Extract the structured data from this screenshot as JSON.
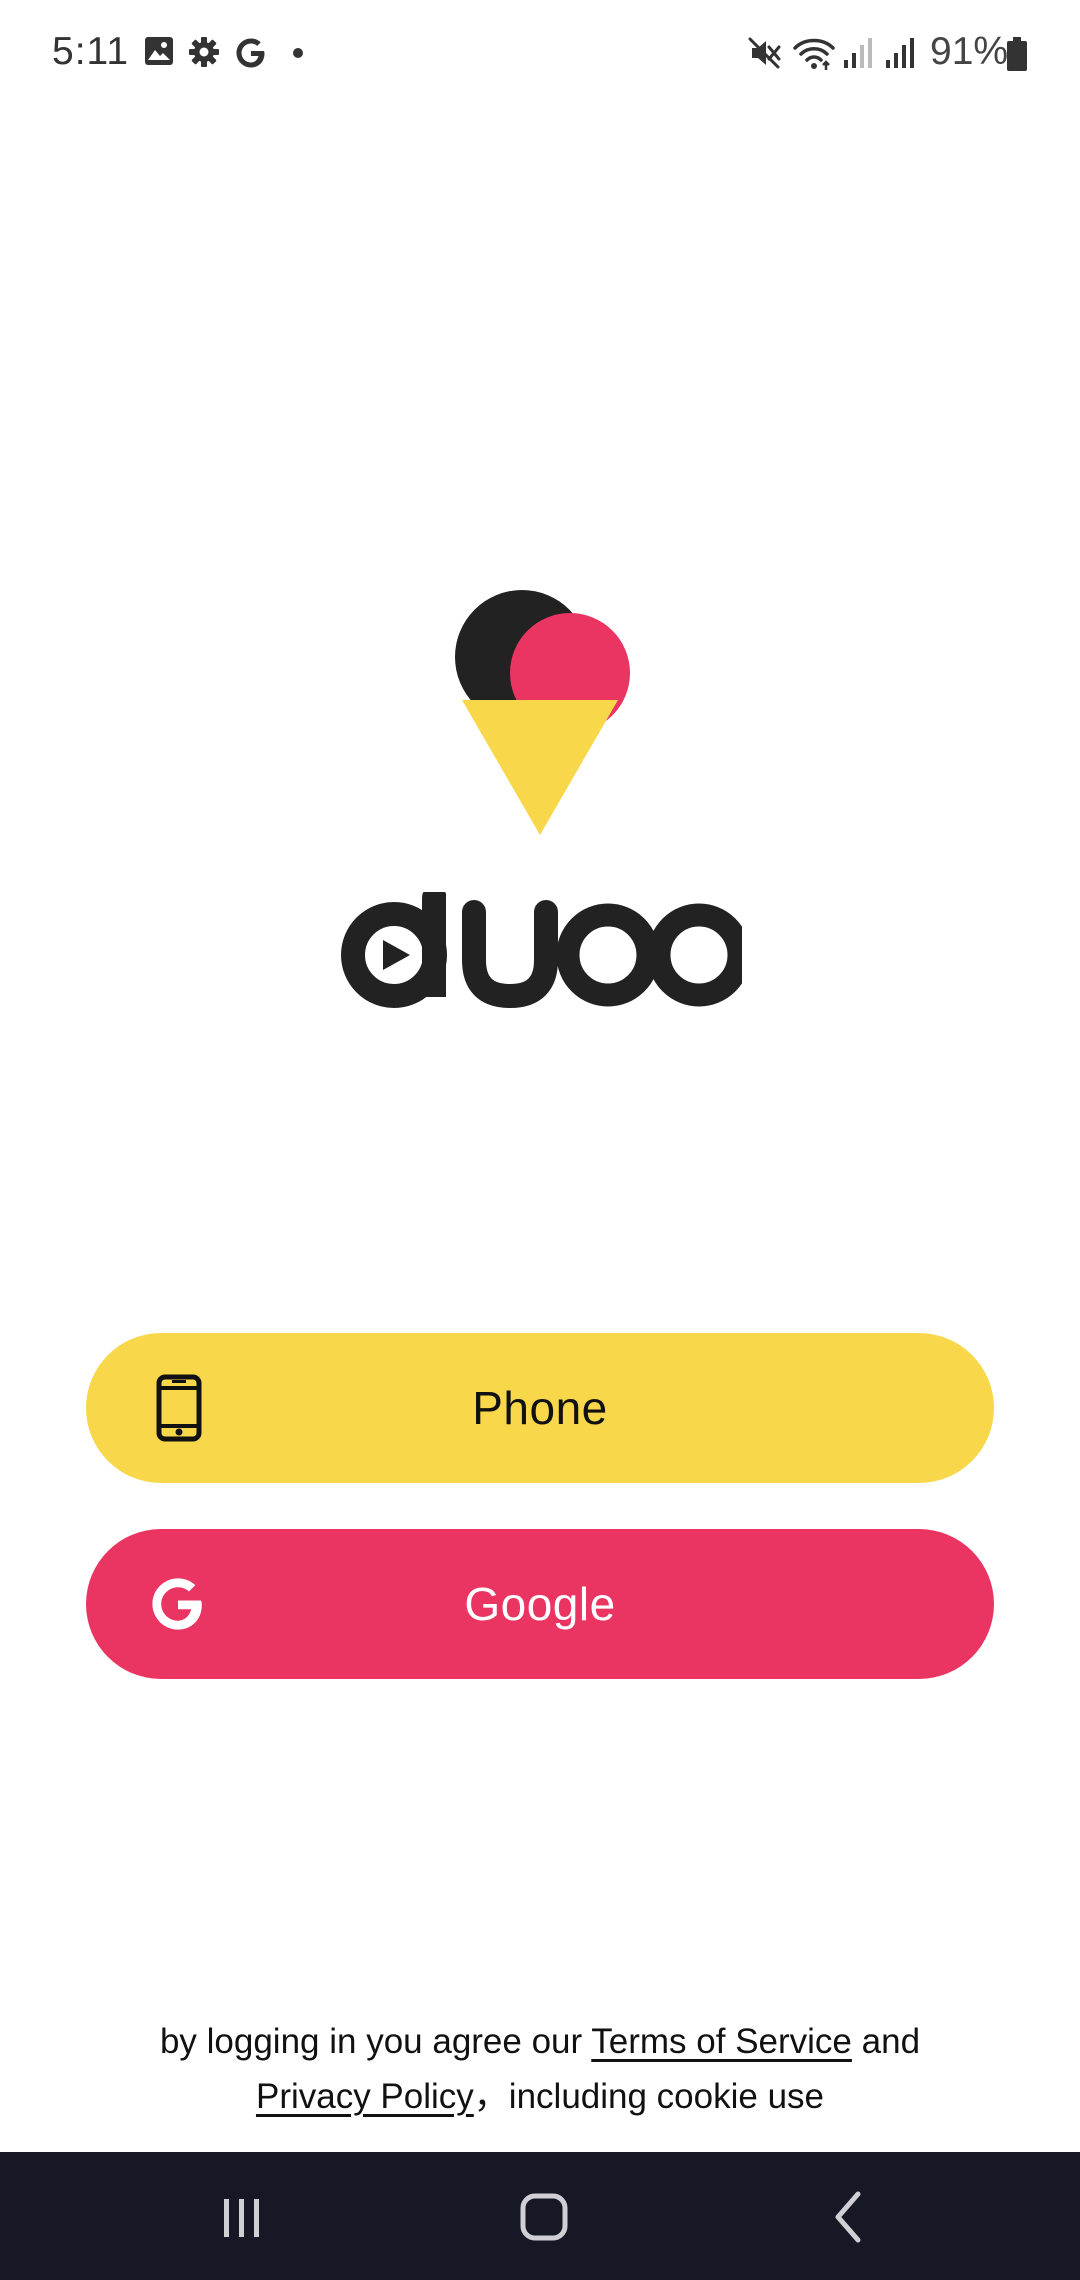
{
  "status_bar": {
    "time": "5:11",
    "left_icons": [
      "gallery-icon",
      "settings-gear-icon",
      "google-icon",
      "notification-dot-icon"
    ],
    "right_icons": [
      "mute-icon",
      "wifi-icon",
      "signal-icon",
      "signal-icon",
      "battery-icon"
    ],
    "battery": "91%"
  },
  "logo": {
    "name": "duoo",
    "colors": {
      "dark": "#222222",
      "pink": "#ea3563",
      "yellow": "#f8d84a"
    }
  },
  "buttons": {
    "phone": {
      "label": "Phone",
      "icon": "mobile-phone-icon",
      "color": "#f8d84a"
    },
    "google": {
      "label": "Google",
      "icon": "google-g-icon",
      "color": "#ea3563"
    }
  },
  "legal": {
    "prefix": "by logging in you agree our",
    "terms": "Terms of Service",
    "and": "and",
    "privacy": "Privacy Policy",
    "suffix": "，including cookie use"
  },
  "nav_bar": {
    "buttons": [
      "recent-apps-icon",
      "home-icon",
      "back-icon"
    ],
    "background": "#171826"
  }
}
